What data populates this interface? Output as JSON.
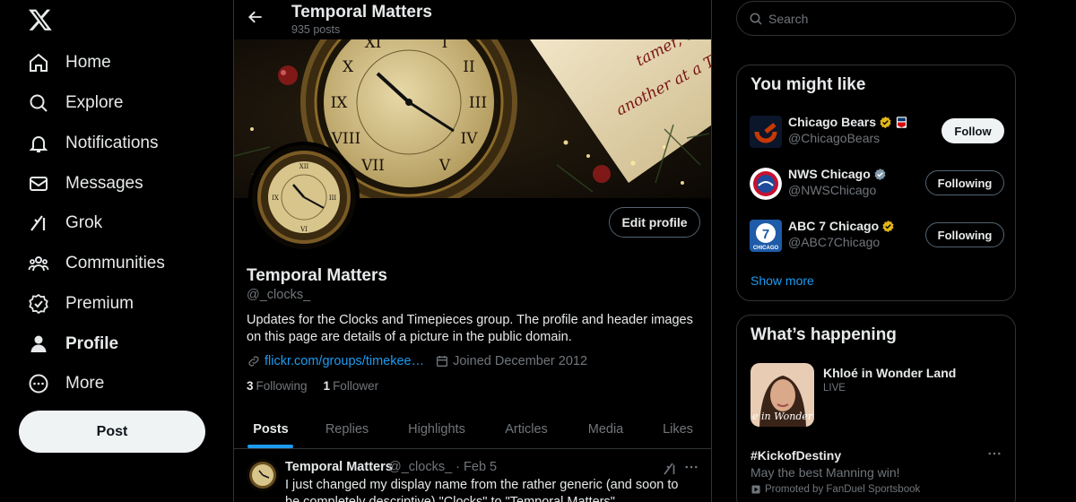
{
  "nav": {
    "logo": "x-logo-icon",
    "items": [
      {
        "label": "Home",
        "icon": "home-icon"
      },
      {
        "label": "Explore",
        "icon": "search-icon"
      },
      {
        "label": "Notifications",
        "icon": "bell-icon"
      },
      {
        "label": "Messages",
        "icon": "envelope-icon"
      },
      {
        "label": "Grok",
        "icon": "grok-icon"
      },
      {
        "label": "Communities",
        "icon": "communities-icon"
      },
      {
        "label": "Premium",
        "icon": "premium-icon"
      },
      {
        "label": "Profile",
        "icon": "person-icon"
      },
      {
        "label": "More",
        "icon": "more-circle-icon"
      }
    ],
    "post_label": "Post"
  },
  "header": {
    "title": "Temporal Matters",
    "posts_count": "935 posts"
  },
  "profile": {
    "name": "Temporal Matters",
    "handle": "@_clocks_",
    "edit_label": "Edit profile",
    "bio": "Updates for the Clocks and Timepieces group. The profile and header images on this page are details of a picture in the public domain.",
    "link": "flickr.com/groups/timekee…",
    "joined": "Joined December 2012",
    "following_count": "3",
    "following_label": "Following",
    "followers_count": "1",
    "followers_label": "Follower",
    "banner_script": "tamer, one another at a Time."
  },
  "tabs": [
    "Posts",
    "Replies",
    "Highlights",
    "Articles",
    "Media",
    "Likes"
  ],
  "active_tab": "Posts",
  "tweet": {
    "name": "Temporal Matters",
    "handle": "@_clocks_",
    "dot": "·",
    "date": "Feb 5",
    "text": "I just changed my display name from the rather generic (and soon to be completely descriptive) \"Clocks\" to \"Temporal Matters\"."
  },
  "search": {
    "placeholder": "Search"
  },
  "suggestions": {
    "title": "You might like",
    "items": [
      {
        "name": "Chicago Bears",
        "handle": "@ChicagoBears",
        "button": "Follow",
        "badge": "gold"
      },
      {
        "name": "NWS Chicago",
        "handle": "@NWSChicago",
        "button": "Following",
        "badge": "gray"
      },
      {
        "name": "ABC 7 Chicago",
        "handle": "@ABC7Chicago",
        "button": "Following",
        "badge": "gold"
      }
    ],
    "show_more": "Show more"
  },
  "happening": {
    "title": "What’s happening",
    "live_title": "Khloé in Wonder Land",
    "live_label": "LIVE",
    "live_image_text": "e in Wonder l",
    "tag": "#KickofDestiny",
    "tag_sub": "May the best Manning win!",
    "promo": "Promoted by FanDuel Sportsbook"
  },
  "abc_logo_text": "7",
  "abc_logo_sub": "CHICAGO",
  "colors": {
    "accent": "#1d9bf0",
    "gold_badge": "#e2b719",
    "gray_badge": "#829aab",
    "border": "#2f3336"
  }
}
